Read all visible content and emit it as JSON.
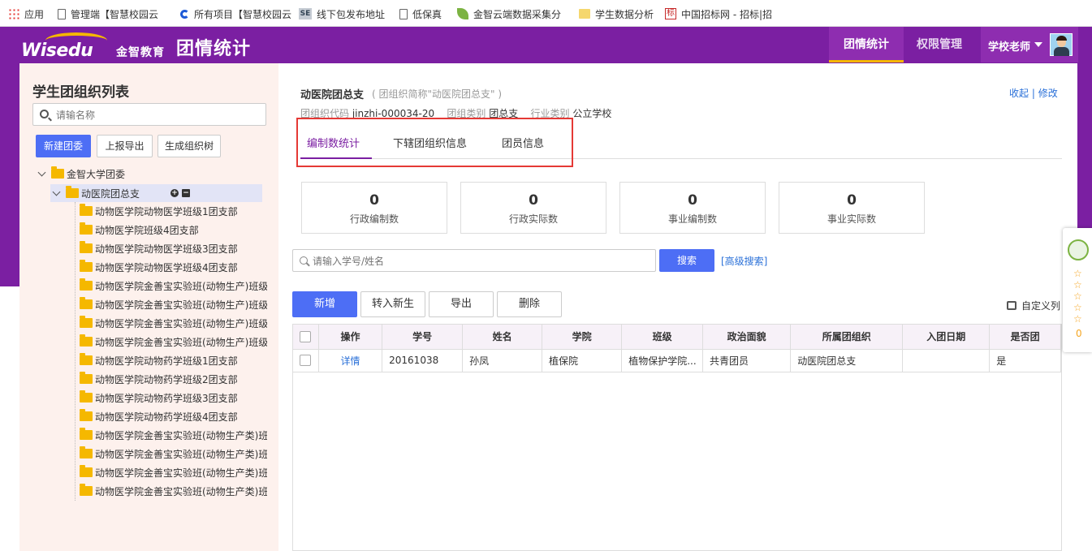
{
  "bookmarks": [
    {
      "label": "应用",
      "icon": "apps-grid-icon"
    },
    {
      "label": "管理端【智慧校园云",
      "icon": "page-icon"
    },
    {
      "label": "所有项目【智慧校园云",
      "icon": "project-c-icon"
    },
    {
      "label": "线下包发布地址",
      "icon": "se-icon"
    },
    {
      "label": "低保真",
      "icon": "page-icon"
    },
    {
      "label": "金智云端数据采集分",
      "icon": "leaf-icon"
    },
    {
      "label": "学生数据分析",
      "icon": "folder-icon"
    },
    {
      "label": "中国招标网 - 招标|招",
      "icon": "bid-icon"
    }
  ],
  "header": {
    "logo_text": "Wisedu",
    "logo_cn": "金智教育",
    "app_title": "团情统计",
    "nav": [
      "团情统计",
      "权限管理"
    ],
    "user": "学校老师"
  },
  "sidebar": {
    "title": "学生团组织列表",
    "search_placeholder": "请输名称",
    "buttons": [
      "新建团委",
      "上报导出",
      "生成组织树"
    ],
    "root": "金智大学团委",
    "selected": "动医院团总支",
    "children": [
      "动物医学院动物医学班级1团支部",
      "动物医学院班级4团支部",
      "动物医学院动物医学班级3团支部",
      "动物医学院动物医学班级4团支部",
      "动物医学院金善宝实验班(动物生产)班级",
      "动物医学院金善宝实验班(动物生产)班级",
      "动物医学院金善宝实验班(动物生产)班级",
      "动物医学院金善宝实验班(动物生产)班级",
      "动物医学院动物药学班级1团支部",
      "动物医学院动物药学班级2团支部",
      "动物医学院动物药学班级3团支部",
      "动物医学院动物药学班级4团支部",
      "动物医学院金善宝实验班(动物生产类)班",
      "动物医学院金善宝实验班(动物生产类)班",
      "动物医学院金善宝实验班(动物生产类)班",
      "动物医学院金善宝实验班(动物生产类)班"
    ]
  },
  "org": {
    "name": "动医院团总支",
    "abbr": "( 团组织简称\"动医院团总支\" )",
    "code_label": "团组织代码",
    "code": "jinzhi-000034-20",
    "type_label": "团组类别",
    "type": "团总支",
    "industry_label": "行业类别",
    "industry": "公立学校",
    "link_collapse": "收起",
    "link_sep": "|",
    "link_edit": "修改"
  },
  "tabs": [
    "编制数统计",
    "下辖团组织信息",
    "团员信息"
  ],
  "stats": [
    {
      "value": "0",
      "label": "行政编制数"
    },
    {
      "value": "0",
      "label": "行政实际数"
    },
    {
      "value": "0",
      "label": "事业编制数"
    },
    {
      "value": "0",
      "label": "事业实际数"
    }
  ],
  "search": {
    "placeholder": "请输入学号/姓名",
    "button": "搜索",
    "advanced": "[高级搜索]"
  },
  "actions": [
    "新增",
    "转入新生",
    "导出",
    "删除"
  ],
  "custom_columns": "自定义列",
  "table": {
    "headers": [
      "操作",
      "学号",
      "姓名",
      "学院",
      "班级",
      "政治面貌",
      "所属团组织",
      "入团日期",
      "是否团"
    ],
    "rows": [
      [
        "详情",
        "20161038",
        "孙凤",
        "植保院",
        "植物保护学院...",
        "共青团员",
        "动医院团总支",
        "",
        "是"
      ]
    ]
  },
  "float_panel": {
    "count": "0",
    "star": "☆"
  }
}
